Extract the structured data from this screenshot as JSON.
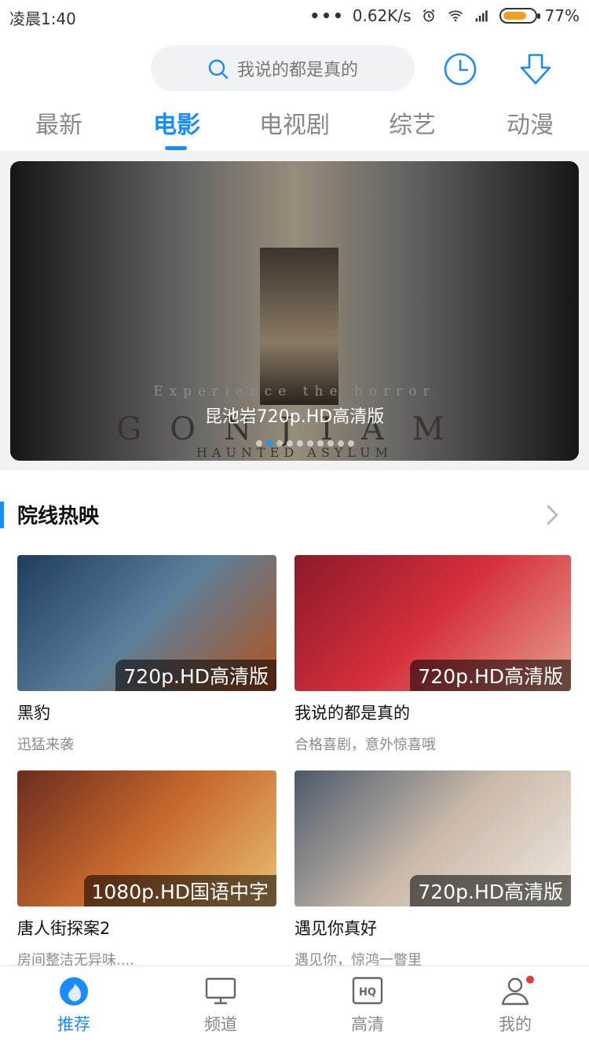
{
  "status_bar": {
    "time": "凌晨1:40",
    "network_speed": "0.62K/s",
    "battery": "77%"
  },
  "search": {
    "placeholder": "我说的都是真的"
  },
  "tabs": [
    {
      "label": "最新"
    },
    {
      "label": "电影"
    },
    {
      "label": "电视剧"
    },
    {
      "label": "综艺"
    },
    {
      "label": "动漫"
    }
  ],
  "active_tab": 1,
  "banner": {
    "tagline": "Experience the horror",
    "title": "昆池岩720p.HD高清版",
    "poster_text": "GONJIAM",
    "poster_sub": "HAUNTED ASYLUM",
    "page_count": 10,
    "current_page": 1
  },
  "section": {
    "title": "院线热映"
  },
  "movies": [
    {
      "name": "黑豹",
      "desc": "迅猛来袭",
      "badge": "720p.HD高清版",
      "poster_colors": [
        "#1f3d5c",
        "#5c7f9a",
        "#b5521c"
      ]
    },
    {
      "name": "我说的都是真的",
      "desc": "合格喜剧，意外惊喜哦",
      "badge": "720p.HD高清版",
      "poster_colors": [
        "#8c1a2b",
        "#d6303c",
        "#e6a08c"
      ]
    },
    {
      "name": "唐人街探案2",
      "desc": "房间整洁无异味....",
      "badge": "1080p.HD国语中字",
      "poster_colors": [
        "#6b2d1e",
        "#c86a2e",
        "#e8c070"
      ]
    },
    {
      "name": "遇见你真好",
      "desc": "遇见你，惊鸿一瞥里",
      "badge": "720p.HD高清版",
      "poster_colors": [
        "#4a5a6a",
        "#c8b8a8",
        "#f0e8e0"
      ]
    }
  ],
  "bottom_nav": [
    {
      "label": "推荐",
      "icon": "flame-icon"
    },
    {
      "label": "频道",
      "icon": "monitor-icon"
    },
    {
      "label": "高清",
      "icon": "hq-icon"
    },
    {
      "label": "我的",
      "icon": "user-icon"
    }
  ],
  "colors": {
    "accent": "#1a8cff",
    "notification": "#e63b2e"
  }
}
